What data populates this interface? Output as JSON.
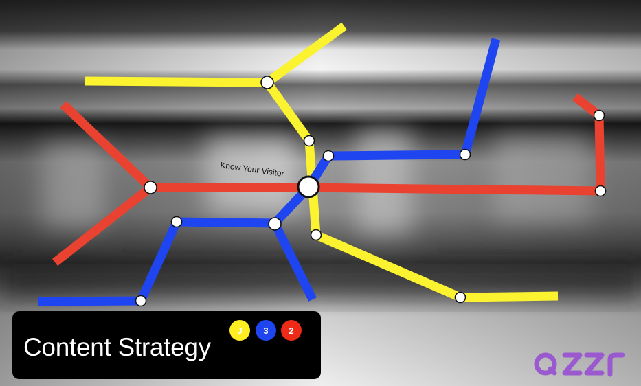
{
  "title": "Content Strategy",
  "station_label": "Know Your Visitor",
  "badges": [
    {
      "label": "J",
      "color": "#ffee22"
    },
    {
      "label": "3",
      "color": "#1f45f0"
    },
    {
      "label": "2",
      "color": "#ee2a18"
    }
  ],
  "line_colors": {
    "yellow": "#fbf230",
    "blue": "#1f45f0",
    "red": "#ea4230"
  },
  "logo": {
    "text": "qzzr",
    "color": "#9b59d0"
  }
}
